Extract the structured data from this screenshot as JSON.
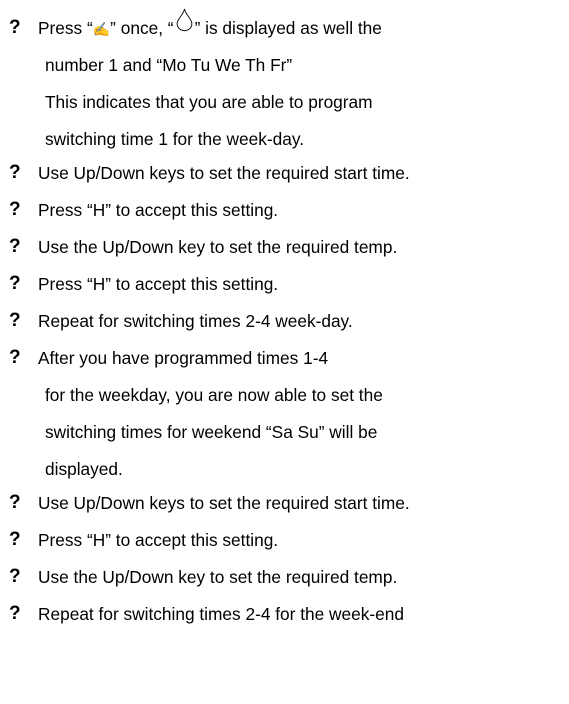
{
  "bullet_glyph": "?",
  "sections": [
    {
      "lines": [
        {
          "pre": "Press “",
          "pencil": "✍",
          "mid": "” once, “",
          "post": "” is displayed as well the"
        },
        {
          "text": "number 1 and “Mo   Tu   We   Th   Fr”"
        },
        {
          "text": "This indicates that you are able to program"
        },
        {
          "text": "switching time 1 for the week-day."
        }
      ]
    },
    {
      "lines": [
        {
          "text": "Use Up/Down keys to set the required start time."
        }
      ]
    },
    {
      "lines": [
        {
          "text": "Press “H” to accept this setting."
        }
      ]
    },
    {
      "lines": [
        {
          "text": "Use the Up/Down key to set the required temp."
        }
      ]
    },
    {
      "lines": [
        {
          "text": "Press “H” to accept this setting."
        }
      ]
    },
    {
      "lines": [
        {
          "text": "Repeat for switching times 2-4 week-day."
        }
      ]
    },
    {
      "lines": [
        {
          "text": "After you have programmed times 1-4"
        },
        {
          "text": "for the weekday, you are now able to set the"
        },
        {
          "text": "switching times for weekend “Sa   Su” will be"
        },
        {
          "text": "displayed."
        }
      ]
    },
    {
      "lines": [
        {
          "text": "Use Up/Down keys to set the required start time."
        }
      ]
    },
    {
      "lines": [
        {
          "text": "Press “H” to accept this setting."
        }
      ]
    },
    {
      "lines": [
        {
          "text": "Use the Up/Down key to set the required temp."
        }
      ]
    },
    {
      "lines": [
        {
          "text": "Repeat for switching times 2-4 for the week-end"
        }
      ]
    }
  ],
  "icons": {
    "pencil": "pencil-icon",
    "drop": "drop-icon"
  }
}
